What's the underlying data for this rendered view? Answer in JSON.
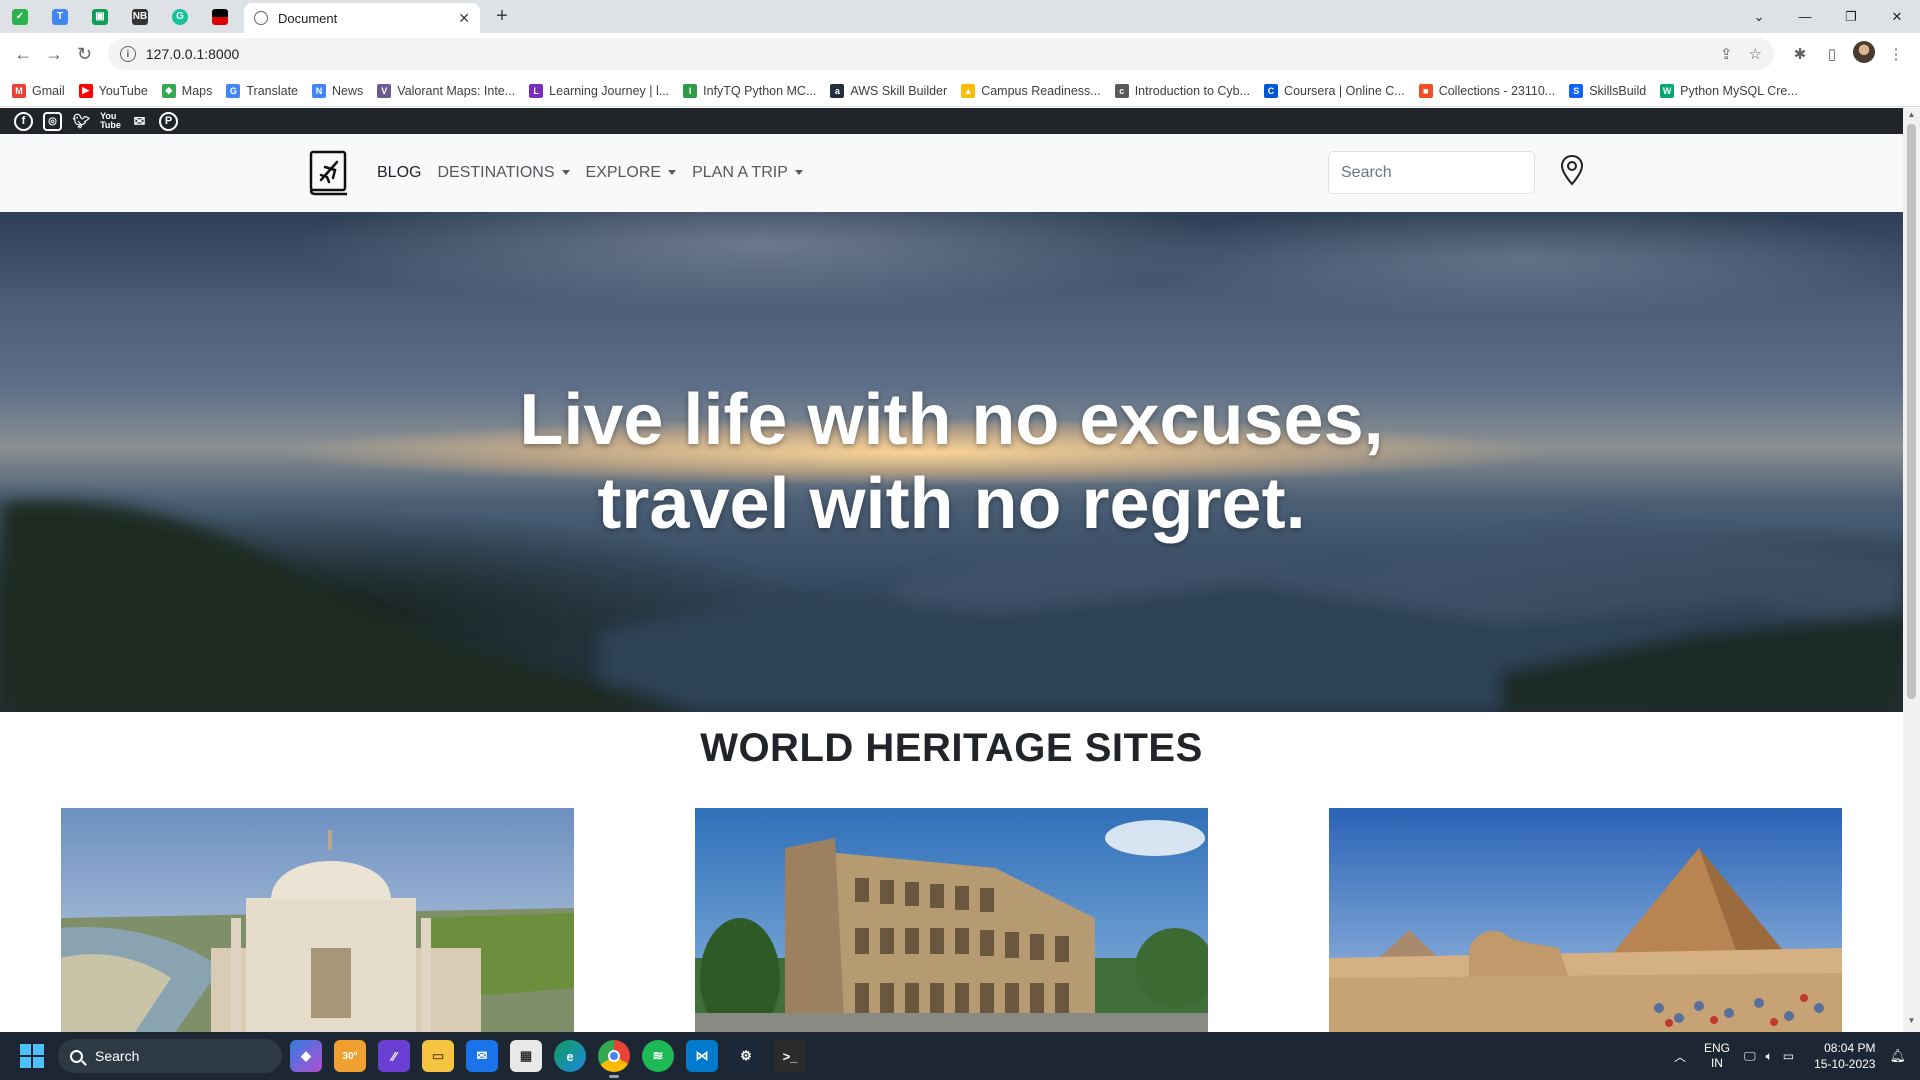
{
  "browser": {
    "tab_title": "Document",
    "url": "127.0.0.1:8000",
    "pinned_tabs": [
      "feedly-icon",
      "translate-icon",
      "sheets-icon",
      "nb-icon",
      "grammarly-icon",
      "flag-icon"
    ],
    "bookmarks": [
      {
        "label": "Gmail",
        "color": "#ea4335",
        "glyph": "M"
      },
      {
        "label": "YouTube",
        "color": "#ff0000",
        "glyph": "▶"
      },
      {
        "label": "Maps",
        "color": "#34a853",
        "glyph": "◆"
      },
      {
        "label": "Translate",
        "color": "#4285f4",
        "glyph": "G"
      },
      {
        "label": "News",
        "color": "#4285f4",
        "glyph": "N"
      },
      {
        "label": "Valorant Maps: Inte...",
        "color": "#6b5b95",
        "glyph": "V"
      },
      {
        "label": "Learning Journey | l...",
        "color": "#7b2cbf",
        "glyph": "L"
      },
      {
        "label": "InfyTQ Python MC...",
        "color": "#2e9b46",
        "glyph": "I"
      },
      {
        "label": "AWS Skill Builder",
        "color": "#232f3e",
        "glyph": "a"
      },
      {
        "label": "Campus Readiness...",
        "color": "#fbbc05",
        "glyph": "▲"
      },
      {
        "label": "Introduction to Cyb...",
        "color": "#5a5a5a",
        "glyph": "c"
      },
      {
        "label": "Coursera | Online C...",
        "color": "#0056d2",
        "glyph": "C"
      },
      {
        "label": "Collections - 23110...",
        "color": "#f25022",
        "glyph": "■"
      },
      {
        "label": "SkillsBuild",
        "color": "#0f62fe",
        "glyph": "S"
      },
      {
        "label": "Python MySQL Cre...",
        "color": "#04aa6d",
        "glyph": "W"
      }
    ]
  },
  "site": {
    "nav": {
      "blog": "BLOG",
      "destinations": "DESTINATIONS",
      "explore": "EXPLORE",
      "plan": "PLAN A TRIP",
      "search_placeholder": "Search"
    },
    "hero": {
      "line1": "Live life with no excuses,",
      "line2": "travel with no regret."
    },
    "section_title": "WORLD HERITAGE SITES",
    "cards": [
      "taj-mahal",
      "colosseum",
      "pyramids-of-giza"
    ]
  },
  "taskbar": {
    "search": "Search",
    "weather": "30°",
    "lang1": "ENG",
    "lang2": "IN",
    "time": "08:04 PM",
    "date": "15-10-2023"
  },
  "colors": {
    "tabstrip": "#dee1e6",
    "site_nav_bg": "#f8f9fa",
    "social_bar": "#212529",
    "taskbar": "#1c2733"
  }
}
